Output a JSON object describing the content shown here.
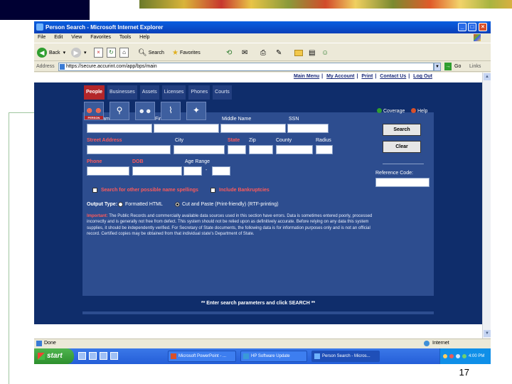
{
  "slide": {
    "page_number": "17"
  },
  "window": {
    "title": "Person Search - Microsoft Internet Explorer",
    "controls": {
      "minimize": "_",
      "maximize": "□",
      "close": "×"
    },
    "menu": [
      "File",
      "Edit",
      "View",
      "Favorites",
      "Tools",
      "Help"
    ],
    "toolbar": {
      "back": "Back",
      "search": "Search",
      "favorites": "Favorites"
    },
    "address": {
      "label": "Address",
      "url": "https://secure.accurint.com/app/bps/main",
      "go": "Go",
      "links": "Links"
    }
  },
  "top_links": [
    "Main Menu",
    "My Account",
    "Print",
    "Contact Us",
    "Log Out"
  ],
  "nav_tabs": [
    {
      "label": "People",
      "active": true
    },
    {
      "label": "Businesses",
      "active": false
    },
    {
      "label": "Assets",
      "active": false
    },
    {
      "label": "Licenses",
      "active": false
    },
    {
      "label": "Phones",
      "active": false
    },
    {
      "label": "Courts",
      "active": false
    }
  ],
  "icon_tabs": [
    {
      "icon": "people-icon",
      "label": "PERSON",
      "active": true
    },
    {
      "icon": "magnifier-icon",
      "label": "",
      "active": false
    },
    {
      "icon": "group-icon",
      "label": "",
      "active": false
    },
    {
      "icon": "map-icon",
      "label": "",
      "active": false
    },
    {
      "icon": "badge-icon",
      "label": "",
      "active": false
    }
  ],
  "form": {
    "labels": {
      "last_name": "Last Name",
      "first_name": "First Name",
      "middle_name": "Middle Name",
      "ssn": "SSN",
      "street_address": "Street Address",
      "city": "City",
      "state": "State",
      "zip": "Zip",
      "county": "County",
      "radius": "Radius",
      "phone": "Phone",
      "dob": "DOB",
      "age_range": "Age Range",
      "age_sep": "-",
      "reference_code": "Reference Code:"
    },
    "coverage": "Coverage",
    "help": "Help",
    "search_button": "Search",
    "clear_button": "Clear",
    "checkbox_spellings": "Search for other possible name spellings",
    "checkbox_bankruptcies": "Include Bankruptcies",
    "output_type_label": "Output Type:",
    "output_options": [
      {
        "label": "Formatted HTML",
        "selected": false
      },
      {
        "label": "Cut and Paste (Print-friendly) (RTF-printing)",
        "selected": true
      }
    ],
    "notice_heading": "Important:",
    "notice_text": "The Public Records and commercially available data sources used in this section have errors. Data is sometimes entered poorly, processed incorrectly and is generally not free from defect. This system should not be relied upon as definitively accurate. Before relying on any data this system supplies, it should be independently verified. For Secretary of State documents, the following data is for information purposes only and is not an official record. Certified copies may be obtained from that individual state's Department of State.",
    "prompt": "** Enter search parameters and click SEARCH **"
  },
  "status": {
    "text": "Done",
    "zone": "Internet"
  },
  "taskbar": {
    "start": "start",
    "buttons": [
      {
        "label": "Microsoft PowerPoint - ...",
        "active": false
      },
      {
        "label": "HP Software Update",
        "active": false
      },
      {
        "label": "Person Search - Micros...",
        "active": true
      }
    ],
    "clock": "4:00 PM"
  },
  "colors": {
    "frame": "#0f2d6b",
    "panel": "#2d4d8f",
    "active_tab": "#b3262a",
    "required_label": "#ff5a5a"
  }
}
